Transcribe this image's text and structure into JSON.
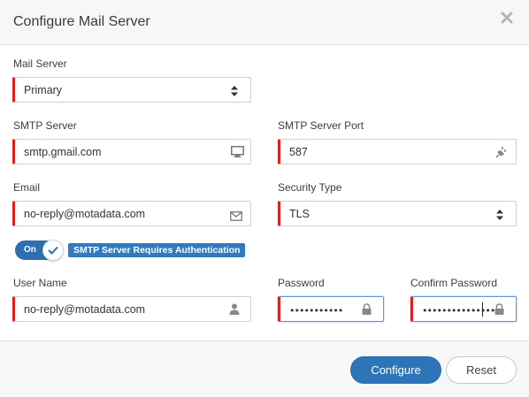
{
  "dialog": {
    "title": "Configure Mail Server",
    "close_icon": "close-icon"
  },
  "mail_server": {
    "label": "Mail Server",
    "value": "Primary",
    "icon": "sort-arrows-icon"
  },
  "smtp_server": {
    "label": "SMTP Server",
    "value": "smtp.gmail.com",
    "icon": "monitor-icon"
  },
  "smtp_port": {
    "label": "SMTP Server Port",
    "value": "587",
    "icon": "plug-icon"
  },
  "email": {
    "label": "Email",
    "value": "no-reply@motadata.com",
    "icon": "envelope-icon"
  },
  "security_type": {
    "label": "Security Type",
    "value": "TLS",
    "icon": "sort-arrows-icon"
  },
  "auth": {
    "toggle_label": "On",
    "toggle_state": true,
    "text": "SMTP Server Requires Authentication"
  },
  "username": {
    "label": "User Name",
    "value": "no-reply@motadata.com",
    "icon": "user-icon"
  },
  "password": {
    "label": "Password",
    "masked": "•••••••••••",
    "icon": "lock-icon"
  },
  "confirm_password": {
    "label": "Confirm Password",
    "masked": "•••••••••••••••••",
    "icon": "lock-icon"
  },
  "footer": {
    "configure_label": "Configure",
    "reset_label": "Reset"
  },
  "colors": {
    "required_marker": "#e02020",
    "primary": "#2e74b8",
    "focus_border": "#5b9bd5"
  }
}
